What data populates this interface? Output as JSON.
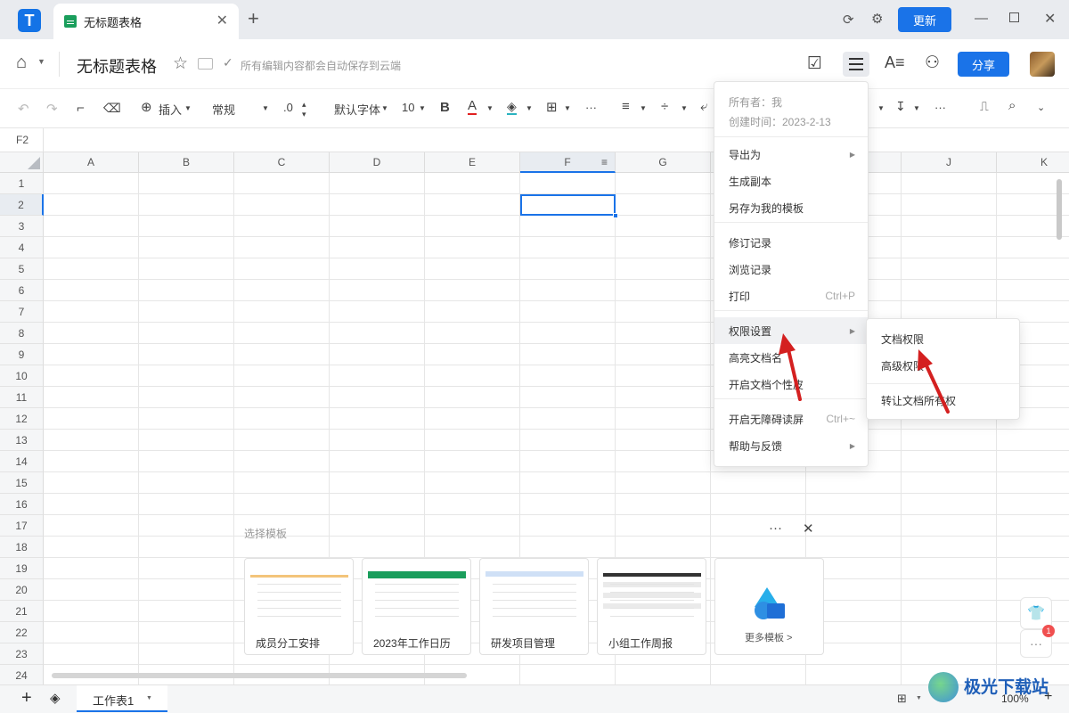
{
  "titlebar": {
    "app_logo": "T",
    "tab_title": "无标题表格",
    "update_label": "更新"
  },
  "header": {
    "doc_title": "无标题表格",
    "autosave_text": "所有编辑内容都会自动保存到云端",
    "share_label": "分享"
  },
  "toolbar": {
    "insert_label": "插入",
    "format_value": "常规",
    "decimal_value": ".0",
    "font_value": "默认字体",
    "font_size_value": "10",
    "bold_label": "B",
    "font_color_label": "A"
  },
  "namebox": {
    "value": "F2"
  },
  "grid": {
    "columns": [
      "A",
      "B",
      "C",
      "D",
      "E",
      "F",
      "G",
      "H",
      "I",
      "J",
      "K"
    ],
    "rows": [
      "1",
      "2",
      "3",
      "4",
      "5",
      "6",
      "7",
      "8",
      "9",
      "10",
      "11",
      "12",
      "13",
      "14",
      "15",
      "16",
      "17",
      "18",
      "19",
      "20",
      "21",
      "22",
      "23",
      "24"
    ],
    "selected_cell": "F2"
  },
  "menu": {
    "owner": "所有者：我",
    "created": "创建时间：2023-2-13",
    "items": [
      {
        "label": "导出为",
        "submenu": true
      },
      {
        "label": "生成副本"
      },
      {
        "label": "另存为我的模板"
      },
      {
        "label": "修订记录"
      },
      {
        "label": "浏览记录"
      },
      {
        "label": "打印",
        "shortcut": "Ctrl+P"
      },
      {
        "label": "权限设置",
        "submenu": true
      },
      {
        "label": "高亮文档名"
      },
      {
        "label": "开启文档个性皮"
      },
      {
        "label": "开启无障碍读屏",
        "shortcut": "Ctrl+~"
      },
      {
        "label": "帮助与反馈",
        "submenu": true
      }
    ]
  },
  "submenu": {
    "items": [
      "文档权限",
      "高级权限",
      "转让文档所有权"
    ]
  },
  "templates": {
    "label": "选择模板",
    "cards": [
      "成员分工安排",
      "2023年工作日历",
      "研发项目管理",
      "小组工作周报"
    ],
    "more_label": "更多模板 >"
  },
  "bottombar": {
    "sheet_tab": "工作表1",
    "zoom": "100%"
  },
  "side": {
    "badge": "1"
  },
  "watermark": "极光下载站",
  "colors": {
    "accent": "#1a73e8",
    "arrow": "#d42020",
    "sheet_green": "#1a9e5c"
  }
}
